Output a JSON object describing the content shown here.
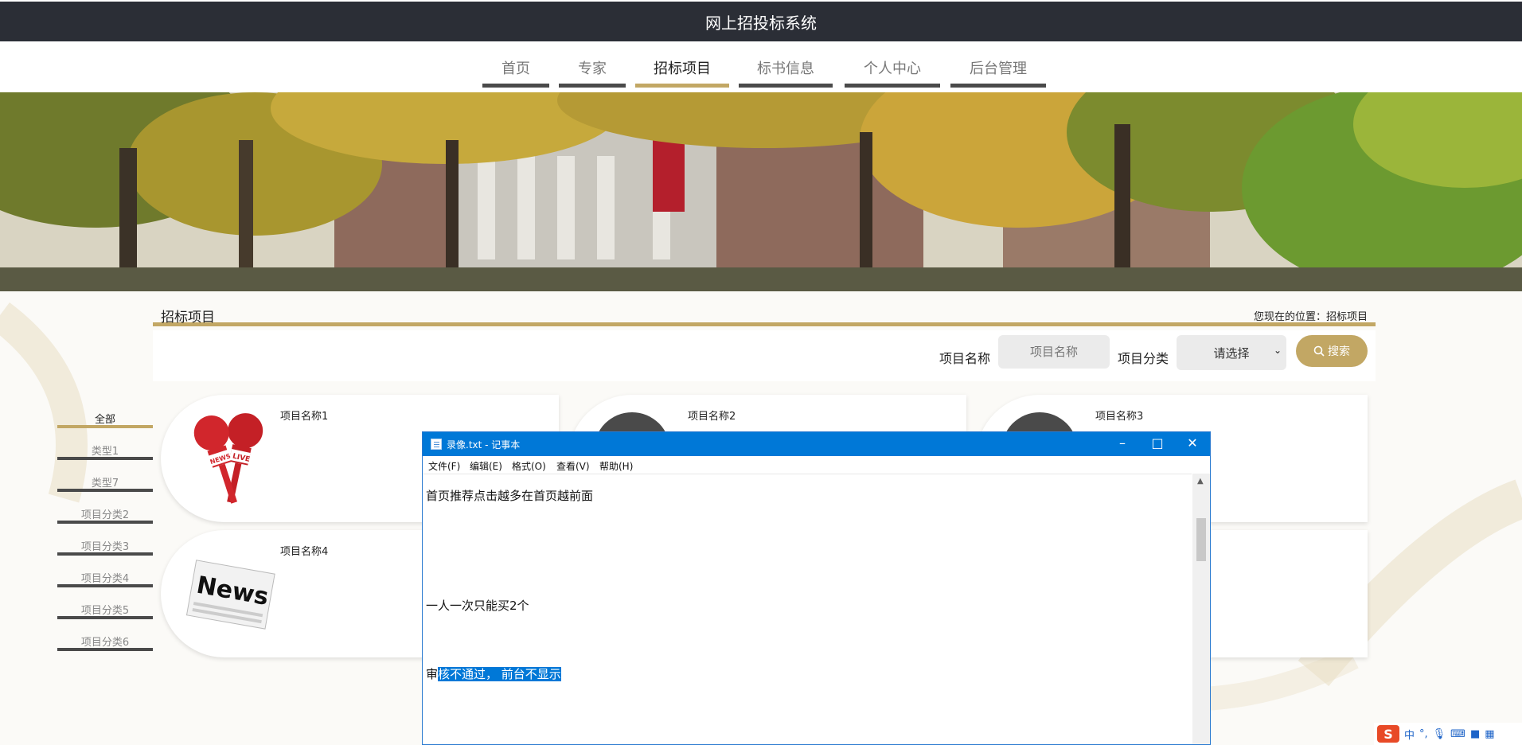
{
  "header": {
    "title": "网上招投标系统"
  },
  "nav": {
    "items": [
      {
        "label": "首页"
      },
      {
        "label": "专家"
      },
      {
        "label": "招标项目"
      },
      {
        "label": "标书信息"
      },
      {
        "label": "个人中心"
      },
      {
        "label": "后台管理"
      }
    ],
    "active_index": 2
  },
  "section": {
    "title": "招标项目",
    "location_prefix": "您现在的位置：",
    "location": "招标项目"
  },
  "search": {
    "name_label": "项目名称",
    "name_placeholder": "项目名称",
    "category_label": "项目分类",
    "category_selected": "请选择",
    "button_label": "搜索"
  },
  "sidebar": {
    "items": [
      {
        "label": "全部"
      },
      {
        "label": "类型1"
      },
      {
        "label": "类型7"
      },
      {
        "label": "项目分类2"
      },
      {
        "label": "项目分类3"
      },
      {
        "label": "项目分类4"
      },
      {
        "label": "项目分类5"
      },
      {
        "label": "项目分类6"
      }
    ],
    "active_index": 0
  },
  "projects": [
    {
      "name": "项目名称1",
      "image": "news-live-microphones-icon"
    },
    {
      "name": "项目名称2",
      "image": "avatar-circle"
    },
    {
      "name": "项目名称3",
      "image": "avatar-circle"
    },
    {
      "name": "项目名称4",
      "image": "news-newspaper-icon"
    }
  ],
  "notepad": {
    "title": "录像.txt - 记事本",
    "menu": [
      "文件(F)",
      "编辑(E)",
      "格式(O)",
      "查看(V)",
      "帮助(H)"
    ],
    "lines": {
      "line1": "首页推荐点击越多在首页越前面",
      "line2": "一人一次只能买2个",
      "line3_prefix": "审",
      "line3_selected": "核不通过， 前台不显示"
    }
  },
  "tray": {
    "ime_logo": "S",
    "ime_mode": "中",
    "punct": "°,"
  },
  "colors": {
    "header_bg": "#2b2e36",
    "accent": "#c2a764",
    "notepad_blue": "#0078d7"
  }
}
